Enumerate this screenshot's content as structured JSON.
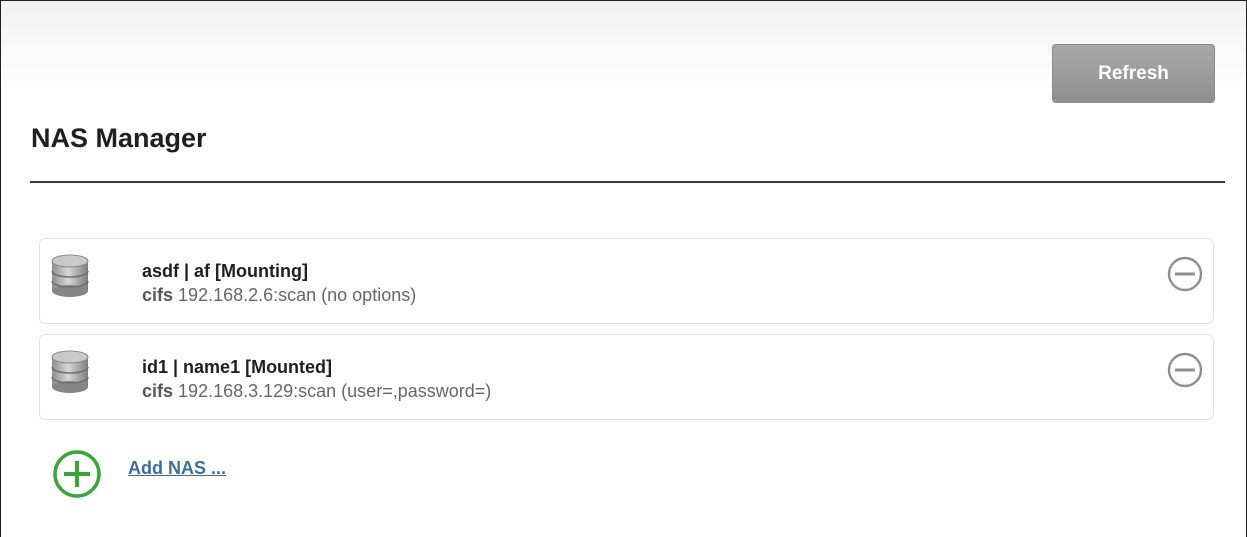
{
  "header": {
    "refresh_label": "Refresh",
    "title": "NAS Manager"
  },
  "nas_list": [
    {
      "title": "asdf | af [Mounting]",
      "protocol": "cifs",
      "detail": "192.168.2.6:scan (no options)"
    },
    {
      "title": "id1 | name1 [Mounted]",
      "protocol": "cifs",
      "detail": "192.168.3.129:scan (user=,password=)"
    }
  ],
  "add_nas_label": "Add NAS ...",
  "icons": {
    "nas": "database-icon",
    "remove": "minus-circle-icon",
    "add": "plus-circle-icon"
  },
  "colors": {
    "accent_green": "#3aa53a",
    "link": "#3d6f96",
    "button_gray": "#9c9c9c"
  }
}
